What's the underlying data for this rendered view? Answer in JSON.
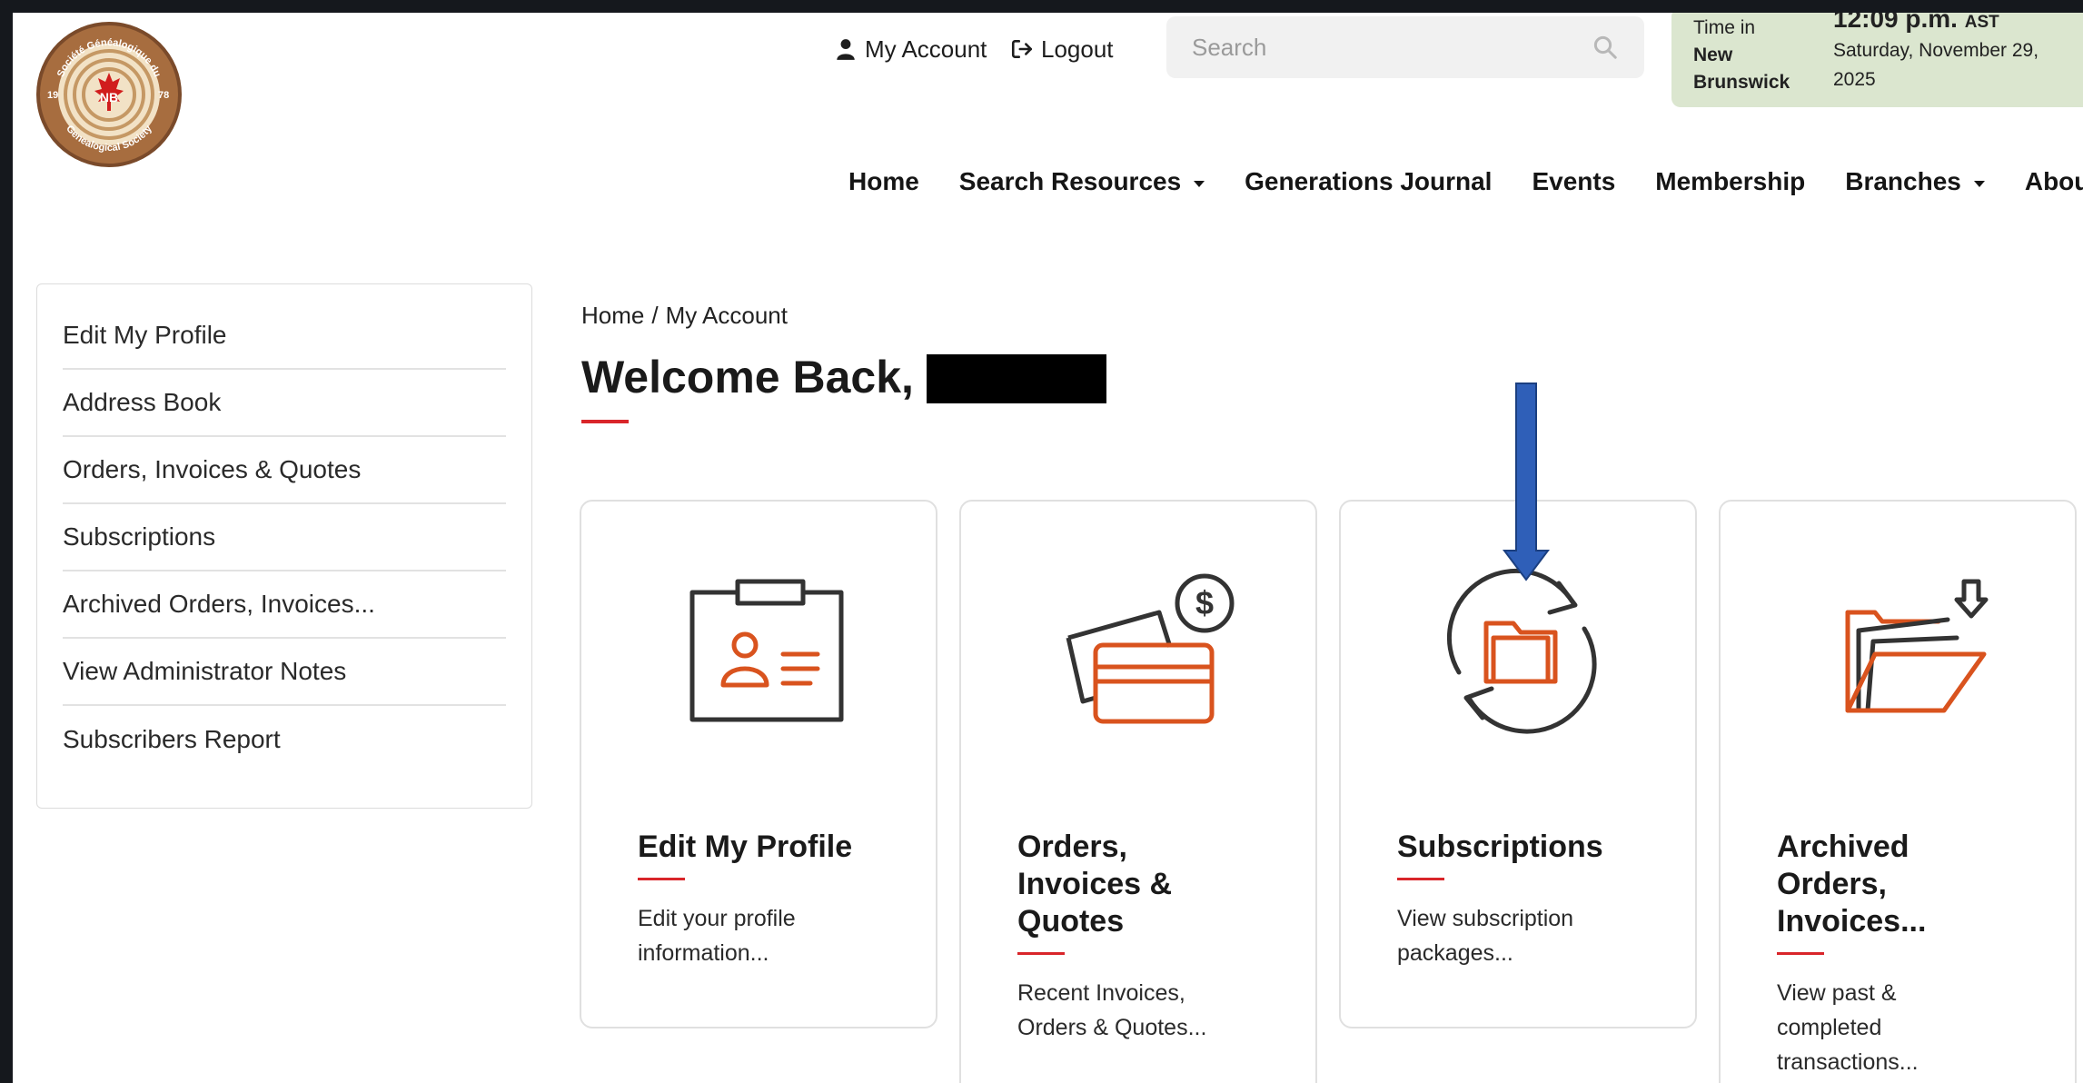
{
  "header": {
    "logo": {
      "text_top": "Société Généalogique du",
      "text_bottom": "Genealogical Society",
      "year_left": "19",
      "year_right": "78",
      "initials": "NB"
    },
    "my_account": "My Account",
    "logout": "Logout",
    "search_placeholder": "Search",
    "time": {
      "label_line1": "Time in",
      "label_line2": "New",
      "label_line3": "Brunswick",
      "clock": "12:09 p.m.",
      "zone": "AST",
      "date_line1": "Saturday, November 29,",
      "date_line2": "2025"
    }
  },
  "nav": {
    "home": "Home",
    "search_resources": "Search Resources",
    "generations_journal": "Generations Journal",
    "events": "Events",
    "membership": "Membership",
    "branches": "Branches",
    "about": "About"
  },
  "sidebar": {
    "items": [
      {
        "label": "Edit My Profile"
      },
      {
        "label": "Address Book"
      },
      {
        "label": "Orders, Invoices & Quotes"
      },
      {
        "label": "Subscriptions"
      },
      {
        "label": "Archived Orders, Invoices..."
      },
      {
        "label": "View Administrator Notes"
      },
      {
        "label": "Subscribers Report"
      }
    ]
  },
  "main": {
    "breadcrumb": {
      "home": "Home",
      "separator": "/",
      "current": "My Account"
    },
    "welcome": "Welcome Back,"
  },
  "cards": [
    {
      "title_lines": [
        "Edit My Profile"
      ],
      "desc_lines": [
        "Edit your profile",
        "information..."
      ],
      "icon": "profile-id-card-icon"
    },
    {
      "title_lines": [
        "Orders,",
        "Invoices &",
        "Quotes"
      ],
      "desc_lines": [
        "Recent Invoices,",
        "Orders & Quotes..."
      ],
      "icon": "credit-cards-dollar-icon"
    },
    {
      "title_lines": [
        "Subscriptions"
      ],
      "desc_lines": [
        "View subscription",
        "packages..."
      ],
      "icon": "folder-sync-icon"
    },
    {
      "title_lines": [
        "Archived",
        "Orders,",
        "Invoices..."
      ],
      "desc_lines": [
        "View past &",
        "completed",
        "transactions..."
      ],
      "icon": "archive-folder-icon"
    }
  ],
  "colors": {
    "accent_red": "#d9252a",
    "icon_orange": "#d9531e",
    "icon_dark": "#333333",
    "time_panel_bg": "#dbe6cf",
    "annotation_arrow": "#2f5fb8"
  }
}
